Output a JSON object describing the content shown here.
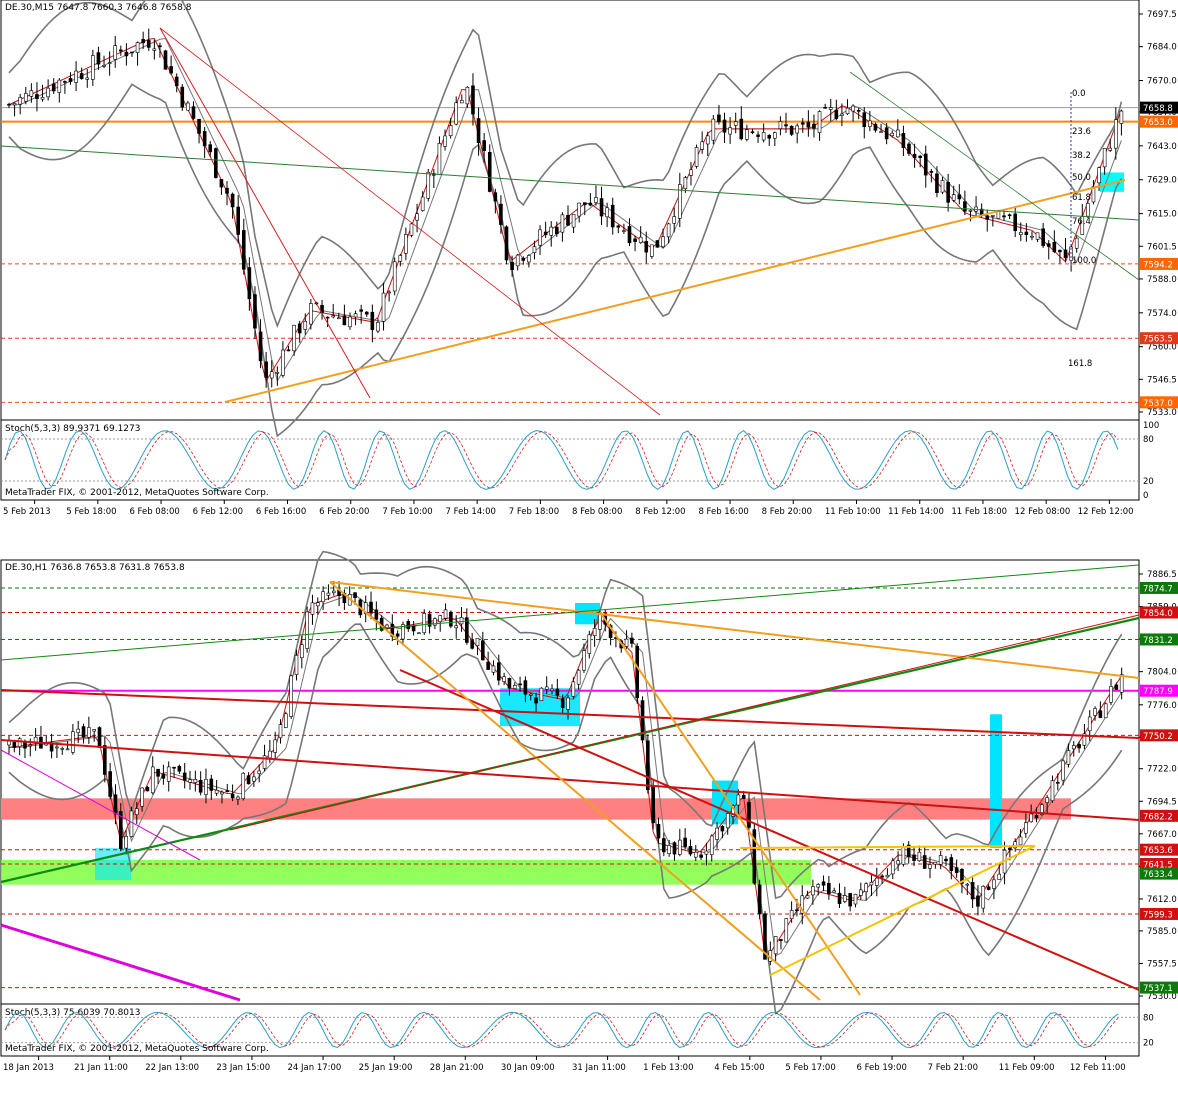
{
  "watermark": "MetaTrader FIX, © 2001-2012, MetaQuotes Software Corp.",
  "chart_data": [
    {
      "type": "candlestick",
      "title": "DE.30,M15  7647.8 7660.3 7646.8 7658.8",
      "timeframe": "M15",
      "ohlc": {
        "open": 7647.8,
        "high": 7660.3,
        "low": 7646.8,
        "close": 7658.8
      },
      "y_ticks": [
        "7697.5",
        "7684.0",
        "7670.0",
        "7657.0",
        "7643.0",
        "7629.0",
        "7615.0",
        "7601.5",
        "7588.0",
        "7574.0",
        "7560.0",
        "7546.5",
        "7533.0"
      ],
      "x_ticks": [
        "5 Feb 2013",
        "5 Feb 18:00",
        "6 Feb 08:00",
        "6 Feb 12:00",
        "6 Feb 16:00",
        "6 Feb 20:00",
        "7 Feb 10:00",
        "7 Feb 14:00",
        "7 Feb 18:00",
        "8 Feb 08:00",
        "8 Feb 12:00",
        "8 Feb 16:00",
        "8 Feb 20:00",
        "11 Feb 10:00",
        "11 Feb 14:00",
        "11 Feb 18:00",
        "12 Feb 08:00",
        "12 Feb 12:00"
      ],
      "price_labels": [
        {
          "text": "7658.8",
          "color": "#000000"
        },
        {
          "text": "7653.0",
          "color": "#ff6600"
        },
        {
          "text": "7594.2",
          "color": "#ff6600"
        },
        {
          "text": "7563.5",
          "color": "#e03a1a"
        },
        {
          "text": "7537.0",
          "color": "#ff6600"
        }
      ],
      "fibonacci": [
        "0.0",
        "23.6",
        "38.2",
        "50.0",
        "61.8",
        "76.4",
        "100.0",
        "161.8"
      ],
      "ylim": [
        7533.0,
        7697.5
      ],
      "indicator": {
        "name": "Stoch(5,3,3) 89.9371 69.1273",
        "levels": [
          "100",
          "80",
          "20",
          "0"
        ]
      }
    },
    {
      "type": "candlestick",
      "title": "DE.30,H1  7636.8 7653.8 7631.8 7653.8",
      "timeframe": "H1",
      "ohlc": {
        "open": 7636.8,
        "high": 7653.8,
        "low": 7631.8,
        "close": 7653.8
      },
      "y_ticks": [
        "7886.5",
        "7859.0",
        "7831.5",
        "7804.0",
        "7776.0",
        "7748.5",
        "7722.0",
        "7694.5",
        "7667.0",
        "7639.5",
        "7612.0",
        "7585.0",
        "7557.5",
        "7530.0"
      ],
      "x_ticks": [
        "18 Jan 2013",
        "21 Jan 11:00",
        "22 Jan 13:00",
        "23 Jan 15:00",
        "24 Jan 17:00",
        "25 Jan 19:00",
        "28 Jan 21:00",
        "30 Jan 09:00",
        "31 Jan 11:00",
        "1 Feb 13:00",
        "4 Feb 15:00",
        "5 Feb 17:00",
        "6 Feb 19:00",
        "7 Feb 21:00",
        "11 Feb 09:00",
        "12 Feb 11:00"
      ],
      "price_labels": [
        {
          "text": "7874.7",
          "color": "#0b7a0b"
        },
        {
          "text": "7854.0",
          "color": "#d01010"
        },
        {
          "text": "7831.2",
          "color": "#0b7a0b"
        },
        {
          "text": "7787.9",
          "color": "#ff00ff"
        },
        {
          "text": "7750.2",
          "color": "#d01010"
        },
        {
          "text": "7682.2",
          "color": "#d01010"
        },
        {
          "text": "7653.6",
          "color": "#d01010"
        },
        {
          "text": "7641.5",
          "color": "#d01010"
        },
        {
          "text": "7633.4",
          "color": "#0b7a0b"
        },
        {
          "text": "7599.3",
          "color": "#d01010"
        },
        {
          "text": "7537.1",
          "color": "#0b7a0b"
        }
      ],
      "ylim": [
        7530.0,
        7886.5
      ],
      "indicator": {
        "name": "Stoch(5,3,3) 75.6039 70.8013",
        "levels": [
          "80",
          "20"
        ]
      }
    }
  ]
}
